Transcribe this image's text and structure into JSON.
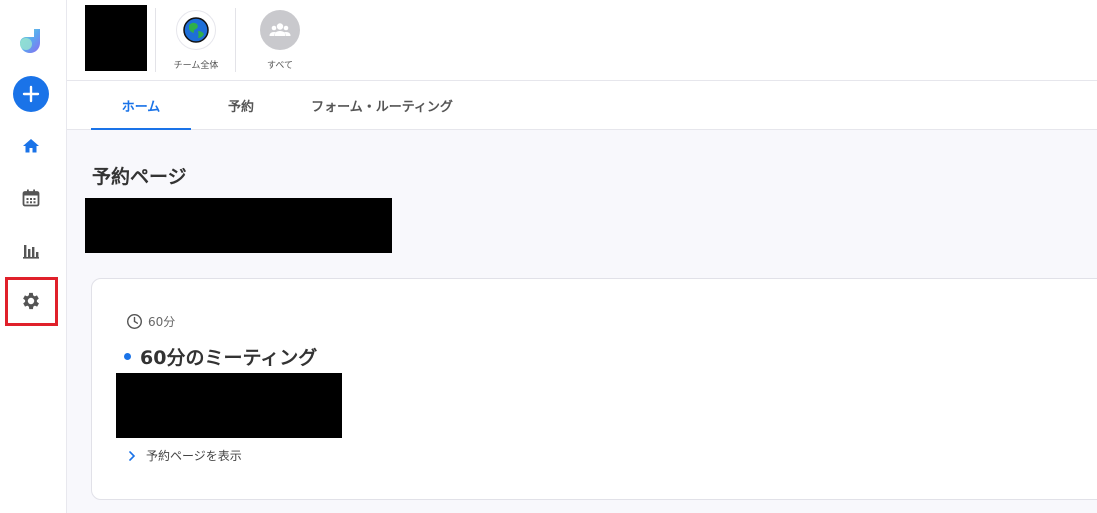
{
  "sidebar": {
    "logo_icon": "brand-logo-icon",
    "add_icon": "plus-icon",
    "items": [
      {
        "name": "home",
        "icon": "home-icon"
      },
      {
        "name": "calendar",
        "icon": "calendar-icon"
      },
      {
        "name": "analytics",
        "icon": "bar-chart-icon"
      },
      {
        "name": "settings",
        "icon": "gear-icon"
      }
    ]
  },
  "topbar": {
    "teams": [
      {
        "label": "チーム全体",
        "icon": "globe-icon"
      },
      {
        "label": "すべて",
        "icon": "group-icon"
      }
    ]
  },
  "tabs": [
    {
      "label": "ホーム",
      "active": true
    },
    {
      "label": "予約",
      "active": false
    },
    {
      "label": "フォーム・ルーティング",
      "active": false
    }
  ],
  "main": {
    "title": "予約ページ",
    "card": {
      "duration": "60分",
      "event_title": "60分のミーティング",
      "link_label": "予約ページを表示"
    }
  },
  "colors": {
    "accent": "#1a73e8",
    "highlight": "#e0202a",
    "background": "#f8f8fc"
  }
}
